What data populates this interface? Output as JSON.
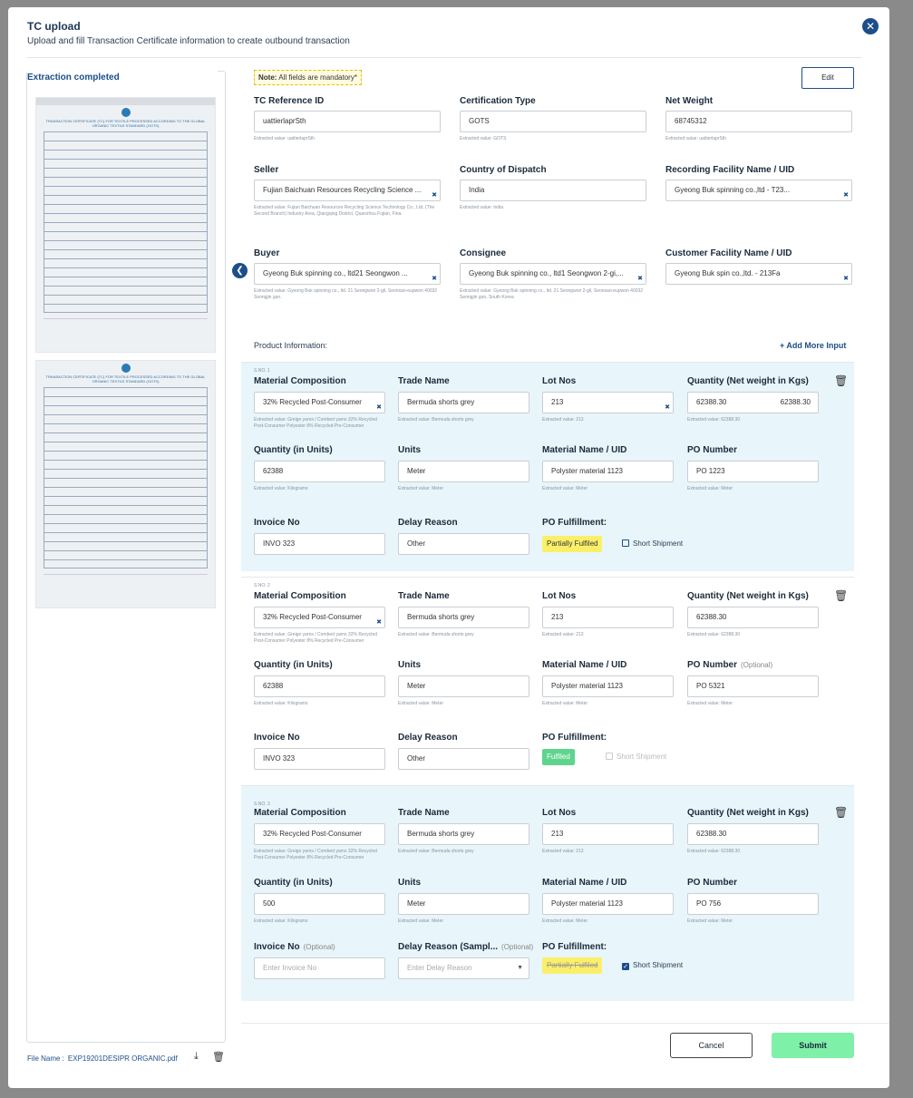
{
  "header": {
    "title": "TC upload",
    "subtitle": "Upload and fill Transaction Certificate information to create outbound transaction"
  },
  "left": {
    "status": "Extraction completed",
    "doc_title": "TRANSACTION CERTIFICATE (TC) FOR TEXTILE PROCESSED ACCORDING TO THE GLOBAL ORGANIC TEXTILE STANDARD (GOTS)",
    "file_label": "File Name :",
    "file_name": "EXP19201DESIPR ORGANIC.pdf"
  },
  "note": {
    "bold": "Note:",
    "text": "All fields are mandatory*"
  },
  "edit_label": "Edit",
  "fields": {
    "tc_ref": {
      "label": "TC Reference ID",
      "value": "uattierlaprSth",
      "extracted": "Extracted value: uattierlaprSth"
    },
    "cert_type": {
      "label": "Certification Type",
      "value": "GOTS",
      "extracted": "Extracted value: GOTS"
    },
    "net_weight": {
      "label": "Net Weight",
      "value": "68745312",
      "extracted": "Extracted value: uattierlaprSth"
    },
    "seller": {
      "label": "Seller",
      "value": "Fujian Baichuan Resources Recycling Science ...",
      "extracted": "Extracted value: Fujian Baichuan Resources Recycling Science Technology Co., Ltd. (The Second Branch) Industry Area, Qiangqing District, Quanzhou Fujian, Fina."
    },
    "country": {
      "label": "Country of Dispatch",
      "value": "India",
      "extracted": "Extracted value: India"
    },
    "recording": {
      "label": "Recording Facility Name / UID",
      "value": "Gyeong Buk spinning co.,ltd - T23..."
    },
    "buyer": {
      "label": "Buyer",
      "value": "Gyeong Buk spinning co., ltd21 Seongwon ...",
      "extracted": "Extracted value: Gyeong Buk spinning co., ltd. 21 Seongwon 2-gil, Seonsan-eupwon 40032 Seongjin gun."
    },
    "consignee": {
      "label": "Consignee",
      "value": "Gyeong Buk spinning co., ltd1 Seongwon 2-gi,...",
      "extracted": "Extracted value: Gyeong Buk spinning co., ltd. 21 Seongwon 2-gil, Seonsan-eupwon 40032 Seongjin gun, South Korea"
    },
    "customer": {
      "label": "Customer Facility Name / UID",
      "value": "Gyeong Buk spin co.,ltd. - 213Fa"
    }
  },
  "product_info_label": "Product Information:",
  "add_more_label": "+ Add More Input",
  "labels": {
    "material": "Material Composition",
    "trade": "Trade Name",
    "lot": "Lot Nos",
    "qty_kg": "Quantity (Net weight in Kgs)",
    "qty_units": "Quantity (in Units)",
    "units": "Units",
    "material_name": "Material Name / UID",
    "po_number": "PO Number",
    "invoice": "Invoice No",
    "delay": "Delay Reason",
    "delay_sample": "Delay Reason (Sampl...",
    "po_fulfillment": "PO Fulfillment:",
    "optional": "(Optional)",
    "short_shipment": "Short Shipment"
  },
  "products": [
    {
      "sno": "S.NO. 1",
      "material": "32% Recycled Post-Consumer",
      "material_ext": "Extracted value: Greige yarns / Combed yarns 32% Recycled Post-Consumer Polyester 8% Recycled Pre-Consumer",
      "trade": "Bermuda shorts grey",
      "trade_ext": "Extracted value: Bermuda shorts grey",
      "lot": "213",
      "lot_ext": "Extracted value: 213",
      "qty_kg": "62388.30",
      "qty_kg_right": "62388.30",
      "qty_kg_ext": "Extracted value: 62388.30",
      "qty_units": "62388",
      "qty_units_ext": "Extracted value: Kilograms",
      "units": "Meter",
      "units_ext": "Extracted value: Meter",
      "material_name": "Polyster material 1123",
      "material_name_ext": "Extracted value: Meter",
      "po_number": "PO 1223",
      "po_number_ext": "Extracted value: Meter",
      "invoice": "INVO 323",
      "delay": "Other",
      "fulfillment": "Partially Fulfiled"
    },
    {
      "sno": "S.NO. 2",
      "material": "32% Recycled Post-Consumer",
      "material_ext": "Extracted value: Greige yarns / Combed yarns 32% Recycled Post-Consumer Polyester 8% Recycled Pre-Consumer",
      "trade": "Bermuda shorts grey",
      "trade_ext": "Extracted value: Bermuda shorts grey",
      "lot": "213",
      "lot_ext": "Extracted value: 213",
      "qty_kg": "62388.30",
      "qty_kg_ext": "Extracted value: 62388.30",
      "qty_units": "62388",
      "qty_units_ext": "Extracted value: Kilograms",
      "units": "Meter",
      "units_ext": "Extracted value: Meter",
      "material_name": "Polyster material 1123",
      "material_name_ext": "Extracted value: Meter",
      "po_number": "PO 5321",
      "po_number_ext": "Extracted value: Meter",
      "invoice": "INVO 323",
      "delay": "Other",
      "fulfillment": "Fulfiled"
    },
    {
      "sno": "S.NO. 3",
      "material": "32% Recycled Post-Consumer",
      "material_ext": "Extracted value: Greige yarns / Combed yarns 32% Recycled Post-Consumer Polyester 8% Recycled Pre-Consumer",
      "trade": "Bermuda shorts grey",
      "trade_ext": "Extracted value: Bermuda shorts grey",
      "lot": "213",
      "lot_ext": "Extracted value: 213",
      "qty_kg": "62388.30",
      "qty_kg_ext": "Extracted value: 62388.30",
      "qty_units": "500",
      "qty_units_ext": "Extracted value: Kilograms",
      "units": "Meter",
      "units_ext": "Extracted value: Meter",
      "material_name": "Polyster material 1123",
      "material_name_ext": "Extracted value: Meter",
      "po_number": "PO 756",
      "po_number_ext": "Extracted value: Meter",
      "invoice_placeholder": "Enter Invoice No",
      "delay_placeholder": "Enter Delay Reason",
      "fulfillment": "Partially Fulfiled"
    }
  ],
  "buttons": {
    "cancel": "Cancel",
    "submit": "Submit"
  },
  "icons": {
    "close": "close-icon",
    "download": "download-icon",
    "trash": "trash-icon",
    "collapse": "chevron-left-icon",
    "clear": "clear-icon"
  },
  "colors": {
    "primary": "#1d4e89",
    "section_bg": "#e8f5fa",
    "partial": "#fbef6a",
    "fulfilled": "#5fd48d",
    "submit": "#7ef0a8"
  }
}
